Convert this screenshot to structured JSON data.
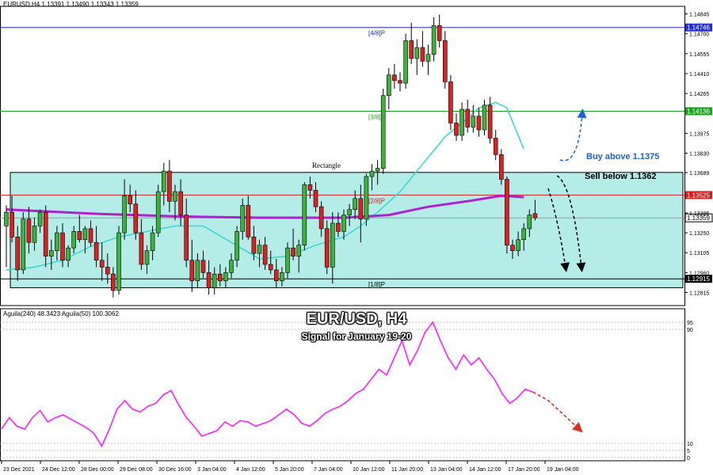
{
  "header": {
    "symbol_line": "EURUSD,H4  1.13391 1.13490 1.13343 1.13359",
    "indicator_line": "Aguila(240) 48.3423  Aguila(50) 100.3062"
  },
  "overlay": {
    "title": "EUR/USD, H4",
    "subtitle": "Signal for January 19-20"
  },
  "colors": {
    "band": "#b4ece8",
    "sma": "#40d8d0",
    "ema": "#b020d0",
    "oscillator": "#ff20ff",
    "bull": "#3cb43c",
    "bear": "#e02020",
    "buy_arrow": "#2060e0",
    "sell_arrow": "#e03020"
  },
  "chart_data": [
    {
      "type": "candlestick",
      "title": "EURUSD,H4",
      "ylim": [
        1.1272,
        1.149
      ],
      "price_ticks": [
        "1.14845",
        "1.14700",
        "1.14555",
        "1.14410",
        "1.14265",
        "1.13975",
        "1.13830",
        "1.13689",
        "1.13395",
        "1.13250",
        "1.13105",
        "1.12960",
        "1.12815"
      ],
      "x_ticks": [
        "23 Dec 2021",
        "24 Dec 12:00",
        "28 Dec 00:00",
        "29 Dec 08:00",
        "30 Dec 16:00",
        "3 Jan 04:00",
        "4 Jan 12:00",
        "5 Jan 20:00",
        "7 Jan 04:00",
        "10 Jan 12:00",
        "11 Jan 20:00",
        "13 Jan 04:00",
        "14 Jan 12:00",
        "17 Jan 20:00",
        "19 Jan 04:00"
      ],
      "levels": [
        {
          "label": "[4/8]P",
          "value": 1.14746,
          "tag": "1.14746",
          "color": "#2030d0"
        },
        {
          "label": "[3/8]P",
          "value": 1.14136,
          "tag": "1.14136",
          "color": "#20a020"
        },
        {
          "label": "[2/8]P",
          "value": 1.13525,
          "tag": "1.13525",
          "color": "#d02020"
        },
        {
          "label": "[1/8]P",
          "value": 1.12915,
          "tag": "1.12915",
          "color": "#000000"
        }
      ],
      "current_price": {
        "value": 1.13359,
        "tag": "1.13359"
      },
      "rectangle": {
        "label": "Rectangle",
        "top": 1.1369,
        "bottom": 1.1285
      },
      "annotations": [
        {
          "text": "Buy above  1.1375",
          "color": "#2060e0"
        },
        {
          "text": "Sell below 1.1362",
          "color": "#000000"
        }
      ],
      "candles": [
        [
          1.133,
          1.1345,
          1.13,
          1.134
        ],
        [
          1.134,
          1.1352,
          1.1318,
          1.1322
        ],
        [
          1.1322,
          1.133,
          1.129,
          1.1298
        ],
        [
          1.1298,
          1.134,
          1.1295,
          1.1335
        ],
        [
          1.1335,
          1.1344,
          1.131,
          1.1318
        ],
        [
          1.1318,
          1.1336,
          1.1312,
          1.133
        ],
        [
          1.133,
          1.1342,
          1.1325,
          1.134
        ],
        [
          1.134,
          1.1345,
          1.13,
          1.1308
        ],
        [
          1.1308,
          1.132,
          1.1298,
          1.1312
        ],
        [
          1.1312,
          1.133,
          1.1305,
          1.1325
        ],
        [
          1.1325,
          1.1332,
          1.13,
          1.1305
        ],
        [
          1.1305,
          1.1316,
          1.13,
          1.1314
        ],
        [
          1.1314,
          1.133,
          1.131,
          1.1326
        ],
        [
          1.1326,
          1.1338,
          1.1318,
          1.132
        ],
        [
          1.132,
          1.133,
          1.131,
          1.1328
        ],
        [
          1.1328,
          1.1334,
          1.1315,
          1.1318
        ],
        [
          1.1318,
          1.133,
          1.13,
          1.1305
        ],
        [
          1.1305,
          1.1318,
          1.129,
          1.13
        ],
        [
          1.13,
          1.131,
          1.1288,
          1.1295
        ],
        [
          1.1295,
          1.13,
          1.1278,
          1.1283
        ],
        [
          1.1283,
          1.133,
          1.128,
          1.1325
        ],
        [
          1.1325,
          1.1364,
          1.132,
          1.1352
        ],
        [
          1.1352,
          1.136,
          1.134,
          1.1346
        ],
        [
          1.1346,
          1.1356,
          1.132,
          1.1325
        ],
        [
          1.1325,
          1.1335,
          1.1298,
          1.1302
        ],
        [
          1.1302,
          1.1316,
          1.1295,
          1.1312
        ],
        [
          1.1312,
          1.133,
          1.1305,
          1.1325
        ],
        [
          1.1325,
          1.136,
          1.1322,
          1.1355
        ],
        [
          1.1355,
          1.1376,
          1.1345,
          1.137
        ],
        [
          1.137,
          1.1378,
          1.134,
          1.1348
        ],
        [
          1.1348,
          1.136,
          1.1334,
          1.1355
        ],
        [
          1.1355,
          1.1364,
          1.133,
          1.1338
        ],
        [
          1.1338,
          1.135,
          1.13,
          1.1305
        ],
        [
          1.1305,
          1.132,
          1.1282,
          1.129
        ],
        [
          1.129,
          1.131,
          1.1285,
          1.1305
        ],
        [
          1.1305,
          1.1312,
          1.1292,
          1.1296
        ],
        [
          1.1296,
          1.1305,
          1.128,
          1.1285
        ],
        [
          1.1285,
          1.13,
          1.128,
          1.1295
        ],
        [
          1.1295,
          1.1302,
          1.1286,
          1.129
        ],
        [
          1.129,
          1.13,
          1.1285,
          1.1296
        ],
        [
          1.1296,
          1.131,
          1.1292,
          1.1305
        ],
        [
          1.1305,
          1.133,
          1.13,
          1.1326
        ],
        [
          1.1326,
          1.135,
          1.132,
          1.1345
        ],
        [
          1.1345,
          1.1352,
          1.132,
          1.1322
        ],
        [
          1.1322,
          1.133,
          1.1305,
          1.131
        ],
        [
          1.131,
          1.132,
          1.13,
          1.1316
        ],
        [
          1.1316,
          1.1322,
          1.1298,
          1.1302
        ],
        [
          1.1302,
          1.1312,
          1.1295,
          1.1298
        ],
        [
          1.1298,
          1.1306,
          1.1285,
          1.129
        ],
        [
          1.129,
          1.13,
          1.1286,
          1.1296
        ],
        [
          1.1296,
          1.1318,
          1.1292,
          1.1314
        ],
        [
          1.1314,
          1.1328,
          1.1305,
          1.1308
        ],
        [
          1.1308,
          1.132,
          1.1296,
          1.1316
        ],
        [
          1.1316,
          1.1362,
          1.1312,
          1.136
        ],
        [
          1.136,
          1.1366,
          1.135,
          1.1356
        ],
        [
          1.1356,
          1.1362,
          1.134,
          1.1344
        ],
        [
          1.1344,
          1.1348,
          1.1322,
          1.1328
        ],
        [
          1.1328,
          1.1334,
          1.1295,
          1.13
        ],
        [
          1.13,
          1.134,
          1.1288,
          1.1332
        ],
        [
          1.1332,
          1.134,
          1.1322,
          1.1326
        ],
        [
          1.1326,
          1.1342,
          1.132,
          1.1338
        ],
        [
          1.1338,
          1.1346,
          1.133,
          1.1342
        ],
        [
          1.1342,
          1.1356,
          1.1335,
          1.135
        ],
        [
          1.135,
          1.136,
          1.1318,
          1.1335
        ],
        [
          1.1335,
          1.1368,
          1.133,
          1.1366
        ],
        [
          1.1366,
          1.1375,
          1.1356,
          1.137
        ],
        [
          1.137,
          1.1378,
          1.136,
          1.1372
        ],
        [
          1.1372,
          1.143,
          1.1368,
          1.1425
        ],
        [
          1.1425,
          1.1445,
          1.1415,
          1.144
        ],
        [
          1.144,
          1.1448,
          1.143,
          1.1436
        ],
        [
          1.1436,
          1.1442,
          1.1428,
          1.1434
        ],
        [
          1.1434,
          1.147,
          1.143,
          1.1465
        ],
        [
          1.1465,
          1.1478,
          1.1448,
          1.1452
        ],
        [
          1.1452,
          1.1466,
          1.144,
          1.146
        ],
        [
          1.146,
          1.1472,
          1.1446,
          1.145
        ],
        [
          1.145,
          1.1462,
          1.144,
          1.1455
        ],
        [
          1.1455,
          1.1482,
          1.145,
          1.1476
        ],
        [
          1.1476,
          1.1484,
          1.146,
          1.1465
        ],
        [
          1.1465,
          1.1472,
          1.143,
          1.1435
        ],
        [
          1.1435,
          1.144,
          1.14,
          1.1405
        ],
        [
          1.1405,
          1.1412,
          1.1392,
          1.1396
        ],
        [
          1.1396,
          1.142,
          1.1392,
          1.1415
        ],
        [
          1.1415,
          1.1422,
          1.1398,
          1.1402
        ],
        [
          1.1402,
          1.1418,
          1.1398,
          1.141
        ],
        [
          1.141,
          1.1416,
          1.1395,
          1.14
        ],
        [
          1.14,
          1.1422,
          1.1396,
          1.1418
        ],
        [
          1.1418,
          1.1424,
          1.139,
          1.1394
        ],
        [
          1.1394,
          1.14,
          1.1378,
          1.1382
        ],
        [
          1.1382,
          1.1386,
          1.136,
          1.1364
        ],
        [
          1.1364,
          1.1366,
          1.131,
          1.1316
        ],
        [
          1.1316,
          1.132,
          1.1306,
          1.1312
        ],
        [
          1.1312,
          1.1326,
          1.1308,
          1.132
        ],
        [
          1.132,
          1.1332,
          1.1312,
          1.1328
        ],
        [
          1.1328,
          1.1342,
          1.1322,
          1.1338
        ],
        [
          1.1339,
          1.1349,
          1.1334,
          1.1336
        ]
      ],
      "ema240": [
        [
          0,
          1.1342
        ],
        [
          15,
          1.1339
        ],
        [
          30,
          1.1337
        ],
        [
          45,
          1.1336
        ],
        [
          60,
          1.1336
        ],
        [
          68,
          1.1338
        ],
        [
          75,
          1.1344
        ],
        [
          82,
          1.1348
        ],
        [
          88,
          1.1352
        ],
        [
          92,
          1.1351
        ]
      ],
      "sma50": [
        [
          0,
          1.1298
        ],
        [
          5,
          1.13
        ],
        [
          10,
          1.1305
        ],
        [
          15,
          1.1315
        ],
        [
          20,
          1.1322
        ],
        [
          25,
          1.1326
        ],
        [
          30,
          1.133
        ],
        [
          35,
          1.133
        ],
        [
          40,
          1.1318
        ],
        [
          45,
          1.1306
        ],
        [
          50,
          1.1308
        ],
        [
          55,
          1.1316
        ],
        [
          60,
          1.1322
        ],
        [
          63,
          1.133
        ],
        [
          66,
          1.134
        ],
        [
          70,
          1.1355
        ],
        [
          74,
          1.1375
        ],
        [
          78,
          1.1395
        ],
        [
          81,
          1.1405
        ],
        [
          84,
          1.1416
        ],
        [
          87,
          1.142
        ],
        [
          89,
          1.1416
        ],
        [
          92,
          1.1386
        ]
      ]
    },
    {
      "type": "line",
      "title": "Aguila(240) 48.3423  Aguila(50) 100.3062",
      "ylim": [
        0,
        100
      ],
      "y_ticks": [
        "95",
        "90",
        "10",
        "5",
        "0"
      ],
      "series": [
        {
          "name": "Aguila(240)",
          "values": [
            [
              0,
              20
            ],
            [
              1,
              28
            ],
            [
              2,
              22
            ],
            [
              3,
              20
            ],
            [
              4,
              28
            ],
            [
              5,
              33
            ],
            [
              6,
              25
            ],
            [
              7,
              28
            ],
            [
              8,
              30
            ],
            [
              9,
              27
            ],
            [
              10,
              24
            ],
            [
              11,
              21
            ],
            [
              12,
              17
            ],
            [
              13,
              8
            ],
            [
              14,
              20
            ],
            [
              15,
              34
            ],
            [
              16,
              40
            ],
            [
              17,
              34
            ],
            [
              18,
              32
            ],
            [
              19,
              36
            ],
            [
              20,
              38
            ],
            [
              21,
              44
            ],
            [
              22,
              47
            ],
            [
              23,
              37
            ],
            [
              24,
              28
            ],
            [
              25,
              22
            ],
            [
              26,
              15
            ],
            [
              27,
              17
            ],
            [
              28,
              19
            ],
            [
              29,
              25
            ],
            [
              30,
              22
            ],
            [
              31,
              26
            ],
            [
              32,
              25
            ],
            [
              33,
              22
            ],
            [
              34,
              24
            ],
            [
              35,
              26
            ],
            [
              36,
              30
            ],
            [
              37,
              34
            ],
            [
              38,
              30
            ],
            [
              39,
              24
            ],
            [
              40,
              22
            ],
            [
              41,
              26
            ],
            [
              42,
              31
            ],
            [
              43,
              34
            ],
            [
              44,
              36
            ],
            [
              45,
              40
            ],
            [
              46,
              45
            ],
            [
              47,
              48
            ],
            [
              48,
              55
            ],
            [
              49,
              62
            ],
            [
              50,
              58
            ],
            [
              51,
              70
            ],
            [
              52,
              82
            ],
            [
              53,
              65
            ],
            [
              54,
              75
            ],
            [
              55,
              88
            ],
            [
              56,
              95
            ],
            [
              57,
              82
            ],
            [
              58,
              70
            ],
            [
              59,
              62
            ],
            [
              60,
              72
            ],
            [
              61,
              65
            ],
            [
              62,
              70
            ],
            [
              63,
              62
            ],
            [
              64,
              55
            ],
            [
              65,
              45
            ],
            [
              66,
              38
            ],
            [
              67,
              42
            ],
            [
              68,
              48
            ],
            [
              69,
              46
            ]
          ]
        },
        {
          "name": "Aguila(50)",
          "values": [
            [
              69,
              46
            ],
            [
              71,
              40
            ],
            [
              73,
              30
            ],
            [
              75,
              20
            ]
          ]
        }
      ]
    }
  ]
}
